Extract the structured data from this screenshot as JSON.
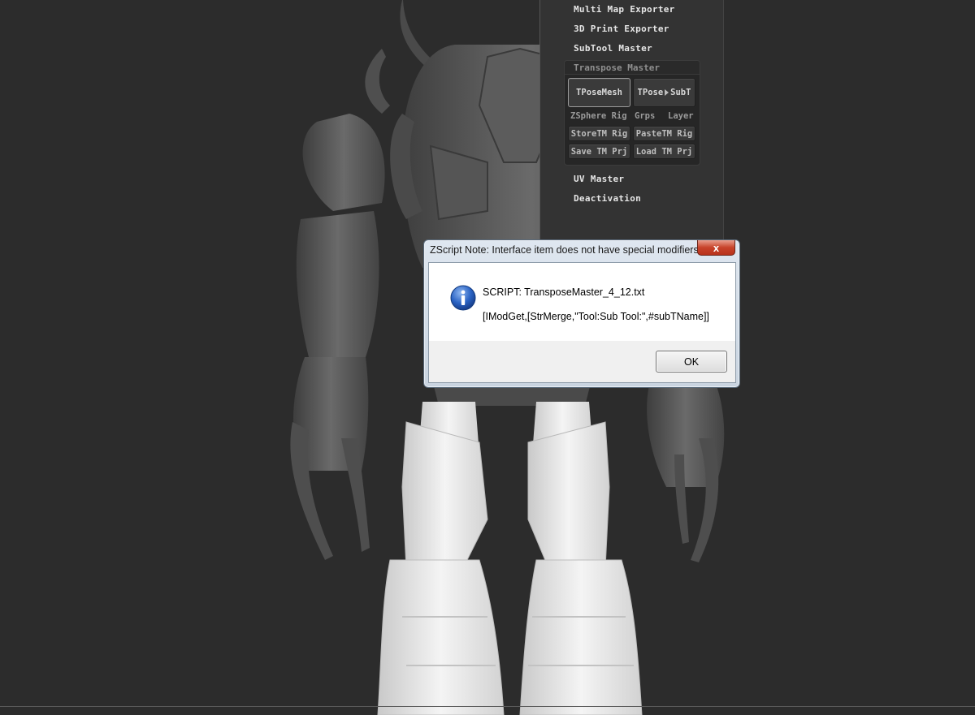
{
  "plugin_menu": {
    "items_top": [
      "Multi Map Exporter",
      "3D Print Exporter",
      "SubTool Master"
    ],
    "transpose_master": {
      "title": "Transpose Master",
      "buttons": {
        "tpose_mesh": "TPoseMesh",
        "tpose_subt_left": "TPose",
        "tpose_subt_right": "SubT",
        "zsphere_rig": "ZSphere Rig",
        "grps": "Grps",
        "layer": "Layer",
        "store_tm_rig": "StoreTM Rig",
        "paste_tm_rig": "PasteTM Rig",
        "save_tm_prj": "Save TM Prj",
        "load_tm_prj": "Load TM Prj"
      }
    },
    "items_bottom": [
      "UV Master",
      "Deactivation"
    ]
  },
  "dialog": {
    "title": "ZScript Note: Interface item does not have special modifiers.",
    "close_glyph": "x",
    "icon": "info-icon",
    "line1": "SCRIPT: TransposeMaster_4_12.txt",
    "line2": "[IModGet,[StrMerge,\"Tool:Sub Tool:\",#subTName]]",
    "ok_label": "OK"
  },
  "colors": {
    "viewport_bg": "#2c2c2c",
    "model_dark": "#5a5a5a",
    "model_light": "#e8e8e8",
    "dialog_close": "#c7432a",
    "info_icon": "#2a63c4"
  }
}
